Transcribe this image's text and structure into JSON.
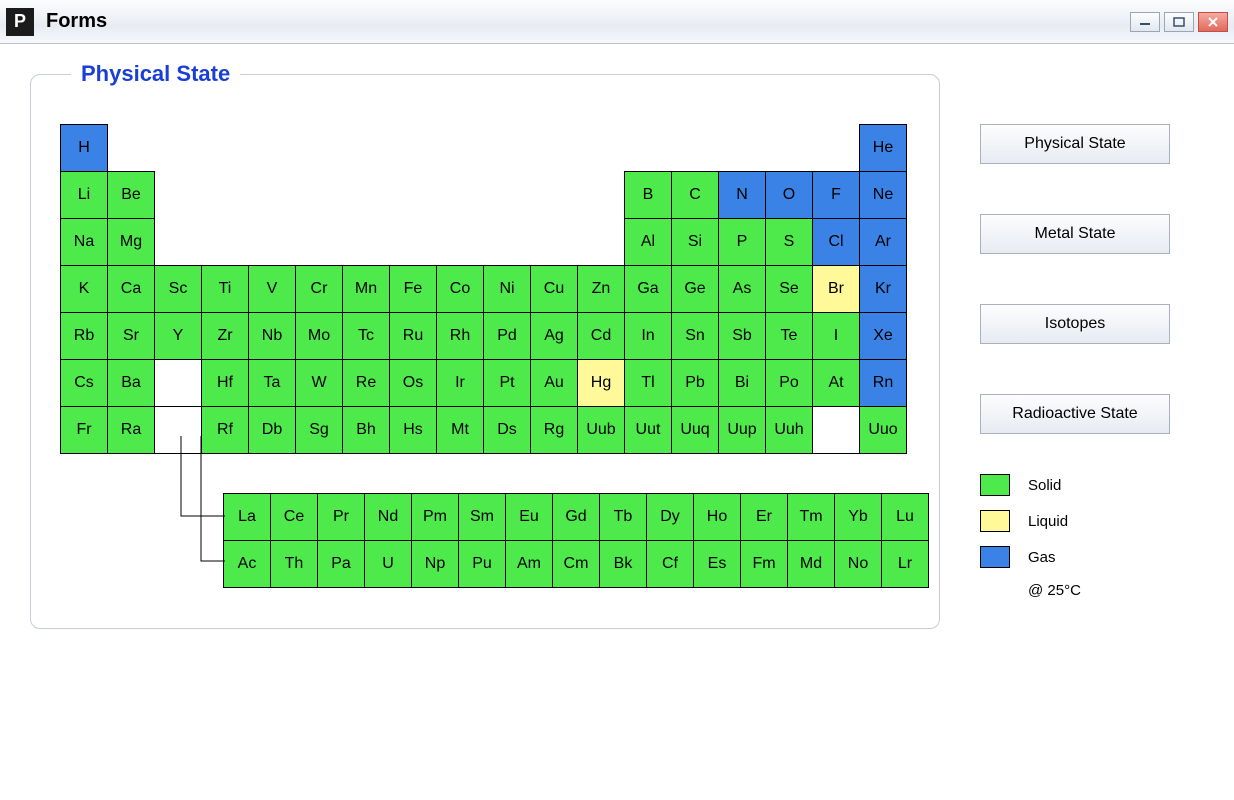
{
  "window": {
    "icon_letter": "P",
    "title": "Forms"
  },
  "group_title": "Physical State",
  "buttons": {
    "physical_state": "Physical State",
    "metal_state": "Metal State",
    "isotopes": "Isotopes",
    "radioactive_state": "Radioactive State"
  },
  "legend": {
    "solid": "Solid",
    "liquid": "Liquid",
    "gas": "Gas",
    "note": "@ 25°C"
  },
  "colors": {
    "solid": "#4eea4b",
    "liquid": "#fff99a",
    "gas": "#3b82e6"
  },
  "elements_main": [
    {
      "sym": "H",
      "row": 1,
      "col": 1,
      "state": "gas"
    },
    {
      "sym": "He",
      "row": 1,
      "col": 18,
      "state": "gas"
    },
    {
      "sym": "Li",
      "row": 2,
      "col": 1,
      "state": "solid"
    },
    {
      "sym": "Be",
      "row": 2,
      "col": 2,
      "state": "solid"
    },
    {
      "sym": "B",
      "row": 2,
      "col": 13,
      "state": "solid"
    },
    {
      "sym": "C",
      "row": 2,
      "col": 14,
      "state": "solid"
    },
    {
      "sym": "N",
      "row": 2,
      "col": 15,
      "state": "gas"
    },
    {
      "sym": "O",
      "row": 2,
      "col": 16,
      "state": "gas"
    },
    {
      "sym": "F",
      "row": 2,
      "col": 17,
      "state": "gas"
    },
    {
      "sym": "Ne",
      "row": 2,
      "col": 18,
      "state": "gas"
    },
    {
      "sym": "Na",
      "row": 3,
      "col": 1,
      "state": "solid"
    },
    {
      "sym": "Mg",
      "row": 3,
      "col": 2,
      "state": "solid"
    },
    {
      "sym": "Al",
      "row": 3,
      "col": 13,
      "state": "solid"
    },
    {
      "sym": "Si",
      "row": 3,
      "col": 14,
      "state": "solid"
    },
    {
      "sym": "P",
      "row": 3,
      "col": 15,
      "state": "solid"
    },
    {
      "sym": "S",
      "row": 3,
      "col": 16,
      "state": "solid"
    },
    {
      "sym": "Cl",
      "row": 3,
      "col": 17,
      "state": "gas"
    },
    {
      "sym": "Ar",
      "row": 3,
      "col": 18,
      "state": "gas"
    },
    {
      "sym": "K",
      "row": 4,
      "col": 1,
      "state": "solid"
    },
    {
      "sym": "Ca",
      "row": 4,
      "col": 2,
      "state": "solid"
    },
    {
      "sym": "Sc",
      "row": 4,
      "col": 3,
      "state": "solid"
    },
    {
      "sym": "Ti",
      "row": 4,
      "col": 4,
      "state": "solid"
    },
    {
      "sym": "V",
      "row": 4,
      "col": 5,
      "state": "solid"
    },
    {
      "sym": "Cr",
      "row": 4,
      "col": 6,
      "state": "solid"
    },
    {
      "sym": "Mn",
      "row": 4,
      "col": 7,
      "state": "solid"
    },
    {
      "sym": "Fe",
      "row": 4,
      "col": 8,
      "state": "solid"
    },
    {
      "sym": "Co",
      "row": 4,
      "col": 9,
      "state": "solid"
    },
    {
      "sym": "Ni",
      "row": 4,
      "col": 10,
      "state": "solid"
    },
    {
      "sym": "Cu",
      "row": 4,
      "col": 11,
      "state": "solid"
    },
    {
      "sym": "Zn",
      "row": 4,
      "col": 12,
      "state": "solid"
    },
    {
      "sym": "Ga",
      "row": 4,
      "col": 13,
      "state": "solid"
    },
    {
      "sym": "Ge",
      "row": 4,
      "col": 14,
      "state": "solid"
    },
    {
      "sym": "As",
      "row": 4,
      "col": 15,
      "state": "solid"
    },
    {
      "sym": "Se",
      "row": 4,
      "col": 16,
      "state": "solid"
    },
    {
      "sym": "Br",
      "row": 4,
      "col": 17,
      "state": "liquid"
    },
    {
      "sym": "Kr",
      "row": 4,
      "col": 18,
      "state": "gas"
    },
    {
      "sym": "Rb",
      "row": 5,
      "col": 1,
      "state": "solid"
    },
    {
      "sym": "Sr",
      "row": 5,
      "col": 2,
      "state": "solid"
    },
    {
      "sym": "Y",
      "row": 5,
      "col": 3,
      "state": "solid"
    },
    {
      "sym": "Zr",
      "row": 5,
      "col": 4,
      "state": "solid"
    },
    {
      "sym": "Nb",
      "row": 5,
      "col": 5,
      "state": "solid"
    },
    {
      "sym": "Mo",
      "row": 5,
      "col": 6,
      "state": "solid"
    },
    {
      "sym": "Tc",
      "row": 5,
      "col": 7,
      "state": "solid"
    },
    {
      "sym": "Ru",
      "row": 5,
      "col": 8,
      "state": "solid"
    },
    {
      "sym": "Rh",
      "row": 5,
      "col": 9,
      "state": "solid"
    },
    {
      "sym": "Pd",
      "row": 5,
      "col": 10,
      "state": "solid"
    },
    {
      "sym": "Ag",
      "row": 5,
      "col": 11,
      "state": "solid"
    },
    {
      "sym": "Cd",
      "row": 5,
      "col": 12,
      "state": "solid"
    },
    {
      "sym": "In",
      "row": 5,
      "col": 13,
      "state": "solid"
    },
    {
      "sym": "Sn",
      "row": 5,
      "col": 14,
      "state": "solid"
    },
    {
      "sym": "Sb",
      "row": 5,
      "col": 15,
      "state": "solid"
    },
    {
      "sym": "Te",
      "row": 5,
      "col": 16,
      "state": "solid"
    },
    {
      "sym": "I",
      "row": 5,
      "col": 17,
      "state": "solid"
    },
    {
      "sym": "Xe",
      "row": 5,
      "col": 18,
      "state": "gas"
    },
    {
      "sym": "Cs",
      "row": 6,
      "col": 1,
      "state": "solid"
    },
    {
      "sym": "Ba",
      "row": 6,
      "col": 2,
      "state": "solid"
    },
    {
      "sym": "",
      "row": 6,
      "col": 3,
      "state": "blank"
    },
    {
      "sym": "Hf",
      "row": 6,
      "col": 4,
      "state": "solid"
    },
    {
      "sym": "Ta",
      "row": 6,
      "col": 5,
      "state": "solid"
    },
    {
      "sym": "W",
      "row": 6,
      "col": 6,
      "state": "solid"
    },
    {
      "sym": "Re",
      "row": 6,
      "col": 7,
      "state": "solid"
    },
    {
      "sym": "Os",
      "row": 6,
      "col": 8,
      "state": "solid"
    },
    {
      "sym": "Ir",
      "row": 6,
      "col": 9,
      "state": "solid"
    },
    {
      "sym": "Pt",
      "row": 6,
      "col": 10,
      "state": "solid"
    },
    {
      "sym": "Au",
      "row": 6,
      "col": 11,
      "state": "solid"
    },
    {
      "sym": "Hg",
      "row": 6,
      "col": 12,
      "state": "liquid"
    },
    {
      "sym": "Tl",
      "row": 6,
      "col": 13,
      "state": "solid"
    },
    {
      "sym": "Pb",
      "row": 6,
      "col": 14,
      "state": "solid"
    },
    {
      "sym": "Bi",
      "row": 6,
      "col": 15,
      "state": "solid"
    },
    {
      "sym": "Po",
      "row": 6,
      "col": 16,
      "state": "solid"
    },
    {
      "sym": "At",
      "row": 6,
      "col": 17,
      "state": "solid"
    },
    {
      "sym": "Rn",
      "row": 6,
      "col": 18,
      "state": "gas"
    },
    {
      "sym": "Fr",
      "row": 7,
      "col": 1,
      "state": "solid"
    },
    {
      "sym": "Ra",
      "row": 7,
      "col": 2,
      "state": "solid"
    },
    {
      "sym": "",
      "row": 7,
      "col": 3,
      "state": "blank"
    },
    {
      "sym": "Rf",
      "row": 7,
      "col": 4,
      "state": "solid"
    },
    {
      "sym": "Db",
      "row": 7,
      "col": 5,
      "state": "solid"
    },
    {
      "sym": "Sg",
      "row": 7,
      "col": 6,
      "state": "solid"
    },
    {
      "sym": "Bh",
      "row": 7,
      "col": 7,
      "state": "solid"
    },
    {
      "sym": "Hs",
      "row": 7,
      "col": 8,
      "state": "solid"
    },
    {
      "sym": "Mt",
      "row": 7,
      "col": 9,
      "state": "solid"
    },
    {
      "sym": "Ds",
      "row": 7,
      "col": 10,
      "state": "solid"
    },
    {
      "sym": "Rg",
      "row": 7,
      "col": 11,
      "state": "solid"
    },
    {
      "sym": "Uub",
      "row": 7,
      "col": 12,
      "state": "solid"
    },
    {
      "sym": "Uut",
      "row": 7,
      "col": 13,
      "state": "solid"
    },
    {
      "sym": "Uuq",
      "row": 7,
      "col": 14,
      "state": "solid"
    },
    {
      "sym": "Uup",
      "row": 7,
      "col": 15,
      "state": "solid"
    },
    {
      "sym": "Uuh",
      "row": 7,
      "col": 16,
      "state": "solid"
    },
    {
      "sym": "",
      "row": 7,
      "col": 17,
      "state": "blank"
    },
    {
      "sym": "Uuo",
      "row": 7,
      "col": 18,
      "state": "solid"
    }
  ],
  "elements_fblock": [
    {
      "sym": "La",
      "row": 1,
      "col": 1,
      "state": "solid"
    },
    {
      "sym": "Ce",
      "row": 1,
      "col": 2,
      "state": "solid"
    },
    {
      "sym": "Pr",
      "row": 1,
      "col": 3,
      "state": "solid"
    },
    {
      "sym": "Nd",
      "row": 1,
      "col": 4,
      "state": "solid"
    },
    {
      "sym": "Pm",
      "row": 1,
      "col": 5,
      "state": "solid"
    },
    {
      "sym": "Sm",
      "row": 1,
      "col": 6,
      "state": "solid"
    },
    {
      "sym": "Eu",
      "row": 1,
      "col": 7,
      "state": "solid"
    },
    {
      "sym": "Gd",
      "row": 1,
      "col": 8,
      "state": "solid"
    },
    {
      "sym": "Tb",
      "row": 1,
      "col": 9,
      "state": "solid"
    },
    {
      "sym": "Dy",
      "row": 1,
      "col": 10,
      "state": "solid"
    },
    {
      "sym": "Ho",
      "row": 1,
      "col": 11,
      "state": "solid"
    },
    {
      "sym": "Er",
      "row": 1,
      "col": 12,
      "state": "solid"
    },
    {
      "sym": "Tm",
      "row": 1,
      "col": 13,
      "state": "solid"
    },
    {
      "sym": "Yb",
      "row": 1,
      "col": 14,
      "state": "solid"
    },
    {
      "sym": "Lu",
      "row": 1,
      "col": 15,
      "state": "solid"
    },
    {
      "sym": "Ac",
      "row": 2,
      "col": 1,
      "state": "solid"
    },
    {
      "sym": "Th",
      "row": 2,
      "col": 2,
      "state": "solid"
    },
    {
      "sym": "Pa",
      "row": 2,
      "col": 3,
      "state": "solid"
    },
    {
      "sym": "U",
      "row": 2,
      "col": 4,
      "state": "solid"
    },
    {
      "sym": "Np",
      "row": 2,
      "col": 5,
      "state": "solid"
    },
    {
      "sym": "Pu",
      "row": 2,
      "col": 6,
      "state": "solid"
    },
    {
      "sym": "Am",
      "row": 2,
      "col": 7,
      "state": "solid"
    },
    {
      "sym": "Cm",
      "row": 2,
      "col": 8,
      "state": "solid"
    },
    {
      "sym": "Bk",
      "row": 2,
      "col": 9,
      "state": "solid"
    },
    {
      "sym": "Cf",
      "row": 2,
      "col": 10,
      "state": "solid"
    },
    {
      "sym": "Es",
      "row": 2,
      "col": 11,
      "state": "solid"
    },
    {
      "sym": "Fm",
      "row": 2,
      "col": 12,
      "state": "solid"
    },
    {
      "sym": "Md",
      "row": 2,
      "col": 13,
      "state": "solid"
    },
    {
      "sym": "No",
      "row": 2,
      "col": 14,
      "state": "solid"
    },
    {
      "sym": "Lr",
      "row": 2,
      "col": 15,
      "state": "solid"
    }
  ]
}
